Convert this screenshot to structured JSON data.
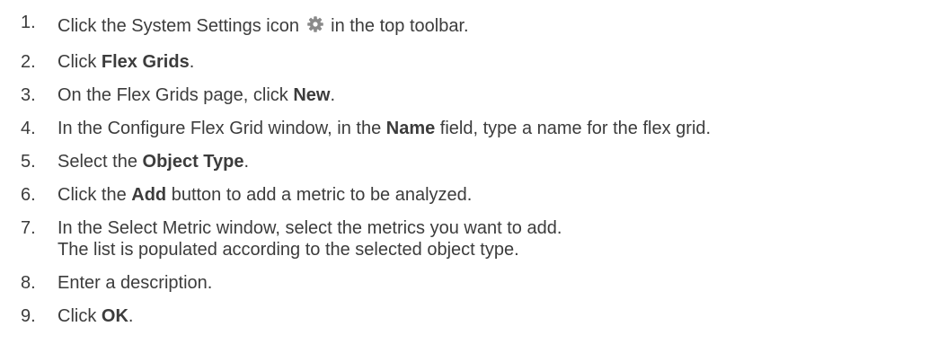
{
  "steps": [
    {
      "number": "1.",
      "before": "Click the System Settings icon",
      "icon": "gear-icon",
      "after": "in the top toolbar."
    },
    {
      "number": "2.",
      "before": "Click ",
      "bold": "Flex Grids",
      "after": "."
    },
    {
      "number": "3.",
      "before": "On the Flex Grids page, click ",
      "bold": "New",
      "after": "."
    },
    {
      "number": "4.",
      "before": "In the Configure Flex Grid window, in the ",
      "bold": "Name",
      "after": " field, type a name for the flex grid."
    },
    {
      "number": "5.",
      "before": "Select the ",
      "bold": "Object Type",
      "after": "."
    },
    {
      "number": "6.",
      "before": "Click the ",
      "bold": "Add",
      "after": " button to add a metric to be analyzed."
    },
    {
      "number": "7.",
      "before": "In the Select Metric window, select the metrics you want to add.",
      "line2": "The list is populated according to the selected object type."
    },
    {
      "number": "8.",
      "before": "Enter a description."
    },
    {
      "number": "9.",
      "before": "Click ",
      "bold": "OK",
      "after": "."
    }
  ],
  "colors": {
    "text": "#3c3c3c",
    "icon": "#8a8a8a"
  }
}
